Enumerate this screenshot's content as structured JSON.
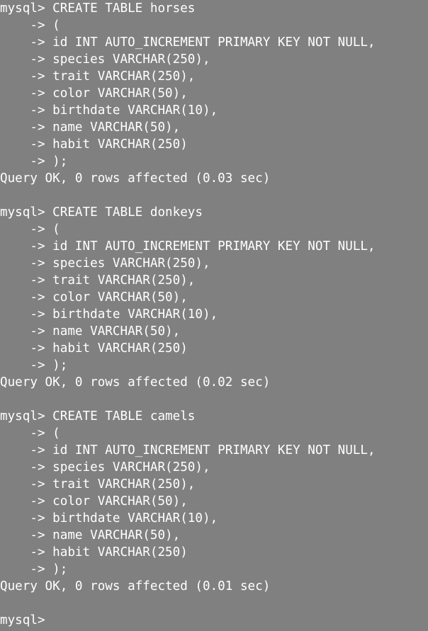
{
  "terminal": {
    "blocks": [
      {
        "lines": [
          "mysql> CREATE TABLE horses",
          "    -> (",
          "    -> id INT AUTO_INCREMENT PRIMARY KEY NOT NULL,",
          "    -> species VARCHAR(250),",
          "    -> trait VARCHAR(250),",
          "    -> color VARCHAR(50),",
          "    -> birthdate VARCHAR(10),",
          "    -> name VARCHAR(50),",
          "    -> habit VARCHAR(250)",
          "    -> );",
          "Query OK, 0 rows affected (0.03 sec)"
        ]
      },
      {
        "lines": [
          "mysql> CREATE TABLE donkeys",
          "    -> (",
          "    -> id INT AUTO_INCREMENT PRIMARY KEY NOT NULL,",
          "    -> species VARCHAR(250),",
          "    -> trait VARCHAR(250),",
          "    -> color VARCHAR(50),",
          "    -> birthdate VARCHAR(10),",
          "    -> name VARCHAR(50),",
          "    -> habit VARCHAR(250)",
          "    -> );",
          "Query OK, 0 rows affected (0.02 sec)"
        ]
      },
      {
        "lines": [
          "mysql> CREATE TABLE camels",
          "    -> (",
          "    -> id INT AUTO_INCREMENT PRIMARY KEY NOT NULL,",
          "    -> species VARCHAR(250),",
          "    -> trait VARCHAR(250),",
          "    -> color VARCHAR(50),",
          "    -> birthdate VARCHAR(10),",
          "    -> name VARCHAR(50),",
          "    -> habit VARCHAR(250)",
          "    -> );",
          "Query OK, 0 rows affected (0.01 sec)"
        ]
      }
    ],
    "prompt": "mysql>",
    "colors": {
      "background": "#808080",
      "text": "#ffffff"
    }
  }
}
